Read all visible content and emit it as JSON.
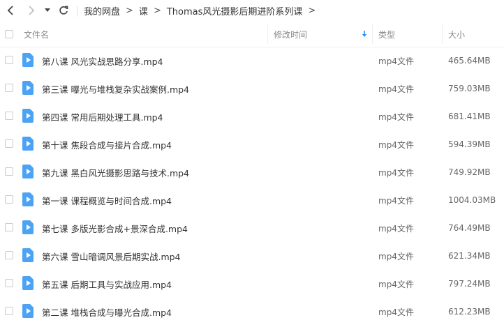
{
  "nav": {
    "breadcrumbs": [
      "我的网盘",
      "课",
      "Thomas风光摄影后期进阶系列课"
    ],
    "separator": ">"
  },
  "columns": {
    "name": "文件名",
    "modified": "修改时间",
    "type": "类型",
    "size": "大小"
  },
  "files": [
    {
      "name": "第八课 风光实战思路分享.mp4",
      "type": "mp4文件",
      "size": "465.64MB"
    },
    {
      "name": "第三课 曝光与堆栈复杂实战案例.mp4",
      "type": "mp4文件",
      "size": "759.03MB"
    },
    {
      "name": "第四课 常用后期处理工具.mp4",
      "type": "mp4文件",
      "size": "681.41MB"
    },
    {
      "name": "第十课 焦段合成与接片合成.mp4",
      "type": "mp4文件",
      "size": "594.39MB"
    },
    {
      "name": "第九课 黑白风光摄影思路与技术.mp4",
      "type": "mp4文件",
      "size": "749.92MB"
    },
    {
      "name": "第一课 课程概览与时间合成.mp4",
      "type": "mp4文件",
      "size": "1004.03MB"
    },
    {
      "name": "第七课 多版光影合成+景深合成.mp4",
      "type": "mp4文件",
      "size": "764.49MB"
    },
    {
      "name": "第六课 雪山暗调风景后期实战.mp4",
      "type": "mp4文件",
      "size": "621.34MB"
    },
    {
      "name": "第五课 后期工具与实战应用.mp4",
      "type": "mp4文件",
      "size": "797.24MB"
    },
    {
      "name": "第二课 堆栈合成与曝光合成.mp4",
      "type": "mp4文件",
      "size": "612.23MB"
    }
  ],
  "colors": {
    "accent": "#2b8ff6",
    "file_icon": "#4ba3f5"
  },
  "icons": {
    "back": "chevron-left-icon",
    "forward": "chevron-right-icon",
    "dropdown": "caret-down-icon",
    "refresh": "refresh-icon",
    "sort": "sort-down-arrow-icon",
    "file": "video-file-icon"
  }
}
